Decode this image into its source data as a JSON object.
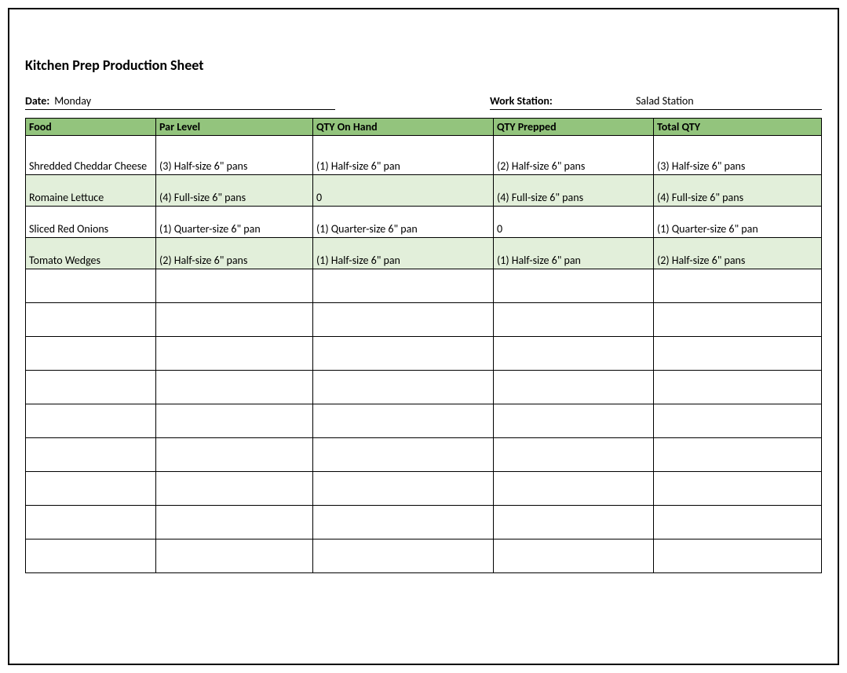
{
  "title": "Kitchen Prep Production Sheet",
  "date_label": "Date:",
  "date_value": "Monday",
  "station_label": "Work Station:",
  "station_value": "Salad Station",
  "headers": [
    "Food",
    "Par Level",
    "QTY On Hand",
    "QTY Prepped",
    "Total QTY"
  ],
  "rows": [
    {
      "food": "Shredded Cheddar Cheese",
      "par": "(3) Half-size 6\" pans",
      "onhand": "(1) Half-size 6\" pan",
      "prepped": "(2) Half-size 6\" pans",
      "total": "(3) Half-size 6\" pans",
      "alt": false,
      "onhand_center": false,
      "prepped_center": false
    },
    {
      "food": "Romaine Lettuce",
      "par": "(4) Full-size 6\" pans",
      "onhand": "0",
      "prepped": "(4) Full-size 6\" pans",
      "total": "(4) Full-size 6\" pans",
      "alt": true,
      "onhand_center": true,
      "prepped_center": false
    },
    {
      "food": "Sliced Red Onions",
      "par": "(1) Quarter-size 6\" pan",
      "onhand": "(1) Quarter-size 6\" pan",
      "prepped": "0",
      "total": "(1) Quarter-size 6\" pan",
      "alt": false,
      "onhand_center": false,
      "prepped_center": true
    },
    {
      "food": "Tomato Wedges",
      "par": "(2) Half-size 6\" pans",
      "onhand": "(1) Half-size 6\" pan",
      "prepped": "(1) Half-size 6\" pan",
      "total": "(2) Half-size 6\" pans",
      "alt": true,
      "onhand_center": false,
      "prepped_center": false
    }
  ],
  "empty_rows": 9
}
